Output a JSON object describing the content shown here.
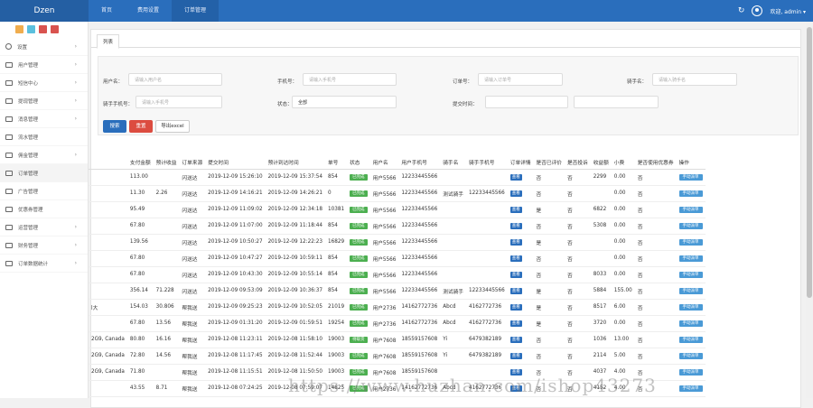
{
  "app": {
    "brand": "Dzen"
  },
  "topnav": [
    "首页",
    "费用设置",
    "订单管理"
  ],
  "topright": {
    "user": "欢迎, admin ▾"
  },
  "sidebar": {
    "quick_colors": [
      "#f0ad4e",
      "#5bc0de",
      "#d9534f",
      "#d9534f"
    ],
    "items": [
      {
        "label": "设置",
        "arrow": "›"
      },
      {
        "label": "用户管理",
        "arrow": "›"
      },
      {
        "label": "短信中心",
        "arrow": "›"
      },
      {
        "label": "提现管理",
        "arrow": "›"
      },
      {
        "label": "消息管理",
        "arrow": "›"
      },
      {
        "label": "流水管理",
        "arrow": ""
      },
      {
        "label": "佣金管理",
        "arrow": "›"
      },
      {
        "label": "订单管理",
        "arrow": ""
      },
      {
        "label": "广告管理",
        "arrow": ""
      },
      {
        "label": "优惠券管理",
        "arrow": ""
      },
      {
        "label": "运营管理",
        "arrow": "›"
      },
      {
        "label": "财务管理",
        "arrow": "›"
      },
      {
        "label": "订单数据统计",
        "arrow": "›"
      }
    ]
  },
  "tab": "列表",
  "filter": {
    "user_name_label": "用户名：",
    "user_name_ph": "请输入用户名",
    "mobile_label": "手机号：",
    "mobile_ph": "请输入手机号",
    "order_label": "订单号：",
    "order_ph": "请输入订单号",
    "rider_label": "骑手名：",
    "rider_ph": "请输入骑手名",
    "rider_mobile_label": "骑手手机号：",
    "rider_mobile_ph": "请输入手机号",
    "status_label": "状态：",
    "status_value": "全部",
    "time_label": "提交时间：",
    "search_btn": "搜索",
    "reset_btn": "重置",
    "export_btn": "导出excel"
  },
  "table": {
    "headers": [
      "",
      "支付金额",
      "预计收益",
      "订单来源",
      "提交时间",
      "预计到达时间",
      "单号",
      "状态",
      "用户名",
      "用户手机号",
      "骑手名",
      "骑手手机号",
      "订单详情",
      "是否已评价",
      "是否投诉",
      "收益额",
      "小费",
      "是否使用优惠券",
      "操作"
    ],
    "rows": [
      [
        "",
        "113.00",
        "",
        "闪送达",
        "2019-12-09 15:26:10",
        "2019-12-09 15:37:54",
        "854",
        "已完成",
        "用户5566",
        "12233445566",
        "",
        "",
        "查看",
        "否",
        "否",
        "2299",
        "0.00",
        "否",
        "手动派单"
      ],
      [
        "",
        "11.30",
        "2.26",
        "闪送达",
        "2019-12-09 14:16:21",
        "2019-12-09 14:26:21",
        "0",
        "已完成",
        "用户5566",
        "12233445566",
        "测试骑手",
        "12233445566",
        "查看",
        "否",
        "否",
        "",
        "0.00",
        "否",
        "手动派单"
      ],
      [
        "",
        "95.49",
        "",
        "闪送达",
        "2019-12-09 11:09:02",
        "2019-12-09 12:34:18",
        "10381",
        "已完成",
        "用户5566",
        "12233445566",
        "",
        "",
        "查看",
        "是",
        "否",
        "6822",
        "0.00",
        "否",
        "手动派单"
      ],
      [
        "",
        "67.80",
        "",
        "闪送达",
        "2019-12-09 11:07:00",
        "2019-12-09 11:18:44",
        "854",
        "已完成",
        "用户5566",
        "12233445566",
        "",
        "",
        "查看",
        "否",
        "否",
        "5308",
        "0.00",
        "否",
        "手动派单"
      ],
      [
        "",
        "139.56",
        "",
        "闪送达",
        "2019-12-09 10:50:27",
        "2019-12-09 12:22:23",
        "16829",
        "已完成",
        "用户5566",
        "12233445566",
        "",
        "",
        "查看",
        "是",
        "否",
        "",
        "0.00",
        "否",
        "手动派单"
      ],
      [
        "",
        "67.80",
        "",
        "闪送达",
        "2019-12-09 10:47:27",
        "2019-12-09 10:59:11",
        "854",
        "已完成",
        "用户5566",
        "12233445566",
        "",
        "",
        "查看",
        "否",
        "否",
        "",
        "0.00",
        "否",
        "手动派单"
      ],
      [
        "",
        "67.80",
        "",
        "闪送达",
        "2019-12-09 10:43:30",
        "2019-12-09 10:55:14",
        "854",
        "已完成",
        "用户5566",
        "12233445566",
        "",
        "",
        "查看",
        "否",
        "否",
        "8033",
        "0.00",
        "否",
        "手动派单"
      ],
      [
        "",
        "356.14",
        "71.228",
        "闪送达",
        "2019-12-09 09:53:09",
        "2019-12-09 10:36:37",
        "854",
        "已完成",
        "用户5566",
        "12233445566",
        "测试骑手",
        "12233445566",
        "查看",
        "是",
        "否",
        "5884",
        "155.00",
        "否",
        "手动派单"
      ],
      [
        "l大",
        "154.03",
        "30.806",
        "帮我送",
        "2019-12-09 09:25:23",
        "2019-12-09 10:52:05",
        "21019",
        "已完成",
        "用户2736",
        "14162772736",
        "Abcd",
        "4162772736",
        "查看",
        "是",
        "否",
        "8517",
        "6.00",
        "否",
        "手动派单"
      ],
      [
        "",
        "67.80",
        "13.56",
        "帮我送",
        "2019-12-09 01:31:20",
        "2019-12-09 01:59:51",
        "19254",
        "已完成",
        "用户2736",
        "14162772736",
        "Abcd",
        "4162772736",
        "查看",
        "是",
        "否",
        "3720",
        "0.00",
        "否",
        "手动派单"
      ],
      [
        "2G9, Canada",
        "80.80",
        "16.16",
        "帮我送",
        "2019-12-08 11:23:11",
        "2019-12-08 11:58:10",
        "19003",
        "待取货",
        "用户7608",
        "18559157608",
        "Yi",
        "6479382189",
        "查看",
        "否",
        "否",
        "1036",
        "13.00",
        "否",
        "手动派单"
      ],
      [
        "2G9, Canada",
        "72.80",
        "14.56",
        "帮我送",
        "2019-12-08 11:17:45",
        "2019-12-08 11:52:44",
        "19003",
        "已完成",
        "用户7608",
        "18559157608",
        "Yi",
        "6479382189",
        "查看",
        "否",
        "否",
        "2114",
        "5.00",
        "否",
        "手动派单"
      ],
      [
        "2G9, Canada",
        "71.80",
        "",
        "帮我送",
        "2019-12-08 11:15:51",
        "2019-12-08 11:50:50",
        "19003",
        "已完成",
        "用户7608",
        "18559157608",
        "",
        "",
        "查看",
        "否",
        "否",
        "4037",
        "4.00",
        "否",
        "手动派单"
      ],
      [
        "",
        "43.55",
        "8.71",
        "帮我送",
        "2019-12-08 07:24:25",
        "2019-12-08 07:59:07",
        "14825",
        "已完成",
        "用户2736",
        "14162772736",
        "Abcd",
        "4162772736",
        "查看",
        "否",
        "否",
        "4152",
        "4.00",
        "否",
        "手动派单"
      ]
    ]
  },
  "watermark": "https://www.huzhan.com/ishop43273"
}
